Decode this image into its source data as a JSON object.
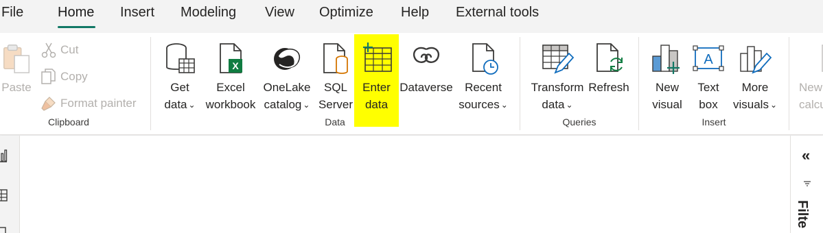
{
  "menu": {
    "tabs": [
      "File",
      "Home",
      "Insert",
      "Modeling",
      "View",
      "Optimize",
      "Help",
      "External tools"
    ],
    "active": "Home",
    "accent_color": "#117865"
  },
  "clipboard": {
    "paste": "Paste",
    "cut": "Cut",
    "copy": "Copy",
    "format_painter": "Format painter",
    "group_label": "Clipboard"
  },
  "data_group": {
    "get_data": [
      "Get",
      "data"
    ],
    "excel": [
      "Excel",
      "workbook"
    ],
    "onelake": [
      "OneLake",
      "catalog"
    ],
    "sql": [
      "SQL",
      "Server"
    ],
    "enter": [
      "Enter",
      "data"
    ],
    "dataverse": "Dataverse",
    "recent": [
      "Recent",
      "sources"
    ],
    "group_label": "Data",
    "highlight_color": "#ffff00"
  },
  "queries": {
    "transform": [
      "Transform",
      "data"
    ],
    "refresh": "Refresh",
    "group_label": "Queries"
  },
  "insert": {
    "new_visual": [
      "New",
      "visual"
    ],
    "text_box": [
      "Text",
      "box"
    ],
    "more_visuals": [
      "More",
      "visuals"
    ],
    "group_label": "Insert"
  },
  "calc": {
    "new_calc": [
      "New",
      "calcu"
    ]
  },
  "right_pane": {
    "collapse": "«",
    "filters": "Filte"
  }
}
